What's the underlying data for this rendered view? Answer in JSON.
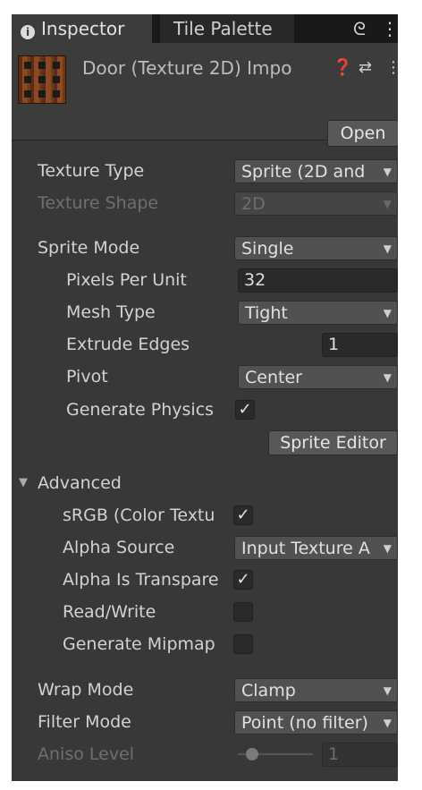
{
  "tabs": {
    "inspector_label": "Inspector",
    "palette_label": "Tile Palette",
    "info_glyph": "i",
    "lock_glyph": "ᘓ",
    "menu_glyph": "⋮"
  },
  "header": {
    "title": "Door (Texture 2D) Impo",
    "help_glyph": "❓",
    "settings_glyph": "⇄",
    "menu_glyph": "⋮",
    "open_label": "Open"
  },
  "fields": {
    "texture_type_label": "Texture Type",
    "texture_type_value": "Sprite (2D and",
    "texture_shape_label": "Texture Shape",
    "texture_shape_value": "2D",
    "sprite_mode_label": "Sprite Mode",
    "sprite_mode_value": "Single",
    "ppu_label": "Pixels Per Unit",
    "ppu_value": "32",
    "mesh_type_label": "Mesh Type",
    "mesh_type_value": "Tight",
    "extrude_label": "Extrude Edges",
    "extrude_value": "1",
    "pivot_label": "Pivot",
    "pivot_value": "Center",
    "gen_physics_label": "Generate Physics",
    "gen_physics_checked": "✓",
    "sprite_editor_label": "Sprite Editor",
    "advanced_label": "Advanced",
    "advanced_arrow": "▼",
    "srgb_label": "sRGB (Color Textu",
    "srgb_checked": "✓",
    "alpha_source_label": "Alpha Source",
    "alpha_source_value": "Input Texture A",
    "alpha_transparency_label": "Alpha Is Transpare",
    "alpha_transparency_checked": "✓",
    "read_write_label": "Read/Write",
    "gen_mipmap_label": "Generate Mipmap",
    "wrap_mode_label": "Wrap Mode",
    "wrap_mode_value": "Clamp",
    "filter_mode_label": "Filter Mode",
    "filter_mode_value": "Point (no filter)",
    "aniso_label": "Aniso Level",
    "aniso_value": "1",
    "dropdown_arrow": "▼"
  }
}
